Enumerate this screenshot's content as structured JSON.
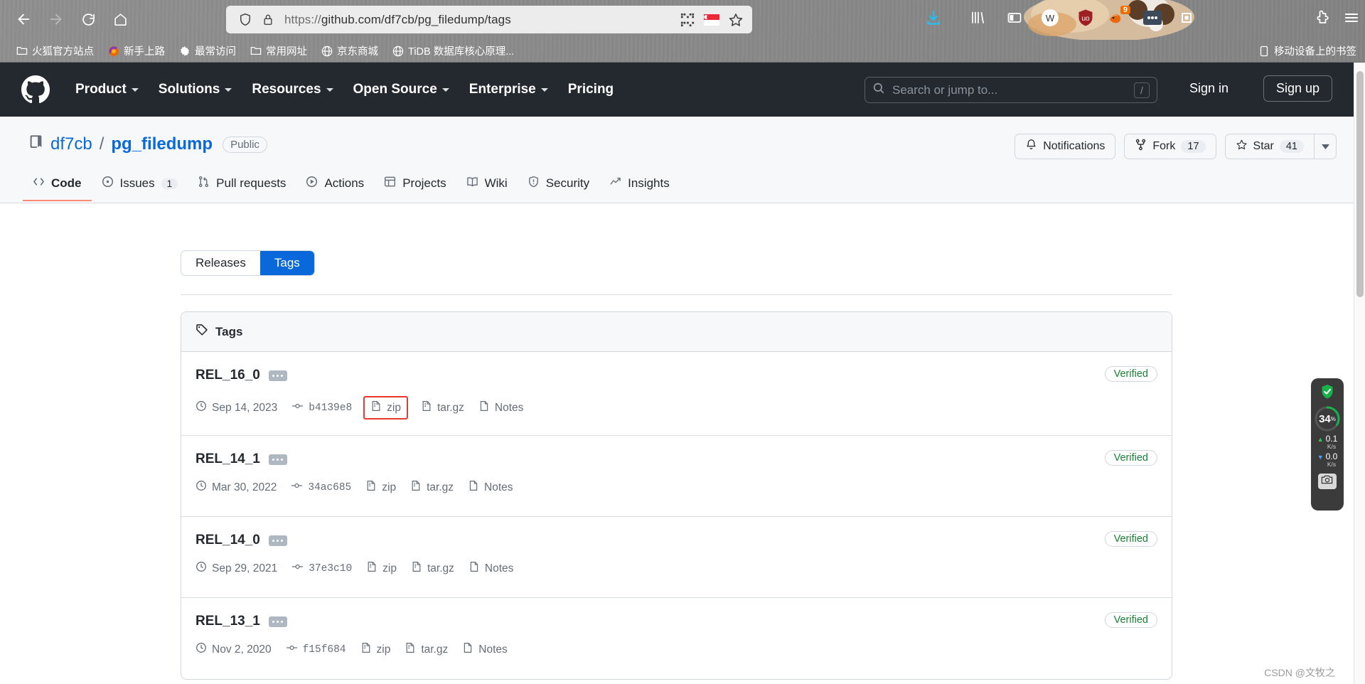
{
  "browser": {
    "back_icon": "back-arrow-icon",
    "forward_icon": "forward-arrow-icon",
    "reload_icon": "reload-icon",
    "home_icon": "home-icon",
    "url_scheme": "https://",
    "url_rest": "github.com/df7cb/pg_filedump/tags",
    "url_full": "https://github.com/df7cb/pg_filedump/tags",
    "shield_icon": "shield-icon",
    "lock_icon": "padlock-icon",
    "qr_icon": "qr-code-icon",
    "flag_icon": "singapore-flag-icon",
    "bookmark_star_icon": "bookmark-star-icon",
    "downloads_icon": "downloads-icon",
    "library_icon": "library-icon",
    "sidebar_icon": "sidebar-icon",
    "account_icon": "w-account-icon",
    "ublock_icon": "ublock-origin-icon",
    "fox_icon": "firefox-extension-icon",
    "fox_badge": "9",
    "dots_ext_icon": "more-extension-icon",
    "screenshot_ext_icon": "screenshot-extension-icon",
    "puzzle_icon": "extensions-puzzle-icon",
    "menu_icon": "hamburger-menu-icon",
    "bookmarks": [
      {
        "label": "火狐官方站点",
        "icon": "folder-icon"
      },
      {
        "label": "新手上路",
        "icon": "firefox-icon"
      },
      {
        "label": "最常访问",
        "icon": "gear-icon"
      },
      {
        "label": "常用网址",
        "icon": "folder-icon"
      },
      {
        "label": "京东商城",
        "icon": "globe-icon"
      },
      {
        "label": "TiDB 数据库核心原理...",
        "icon": "globe-icon"
      }
    ],
    "bookmarks_right": {
      "label": "移动设备上的书签",
      "icon": "mobile-bookmarks-icon"
    }
  },
  "github_header": {
    "logo_icon": "github-mark-icon",
    "nav": [
      {
        "label": "Product",
        "has_caret": true
      },
      {
        "label": "Solutions",
        "has_caret": true
      },
      {
        "label": "Resources",
        "has_caret": true
      },
      {
        "label": "Open Source",
        "has_caret": true
      },
      {
        "label": "Enterprise",
        "has_caret": true
      },
      {
        "label": "Pricing",
        "has_caret": false
      }
    ],
    "search_placeholder": "Search or jump to...",
    "search_icon": "search-icon",
    "search_shortcut": "/",
    "sign_in": "Sign in",
    "sign_up": "Sign up"
  },
  "repo": {
    "book_icon": "repo-book-icon",
    "owner": "df7cb",
    "separator": "/",
    "name": "pg_filedump",
    "visibility": "Public",
    "actions": {
      "notifications_label": "Notifications",
      "notifications_icon": "bell-icon",
      "fork_label": "Fork",
      "fork_count": "17",
      "fork_icon": "fork-icon",
      "star_label": "Star",
      "star_count": "41",
      "star_icon": "star-icon",
      "caret_icon": "chevron-down-icon"
    },
    "tabs": [
      {
        "label": "Code",
        "icon": "code-icon",
        "count": "",
        "active": true
      },
      {
        "label": "Issues",
        "icon": "issue-opened-icon",
        "count": "1",
        "active": false
      },
      {
        "label": "Pull requests",
        "icon": "pull-request-icon",
        "count": "",
        "active": false
      },
      {
        "label": "Actions",
        "icon": "play-icon",
        "count": "",
        "active": false
      },
      {
        "label": "Projects",
        "icon": "table-icon",
        "count": "",
        "active": false
      },
      {
        "label": "Wiki",
        "icon": "book-icon",
        "count": "",
        "active": false
      },
      {
        "label": "Security",
        "icon": "shield-icon",
        "count": "",
        "active": false
      },
      {
        "label": "Insights",
        "icon": "graph-icon",
        "count": "",
        "active": false
      }
    ]
  },
  "main": {
    "toggle": {
      "releases": "Releases",
      "tags": "Tags",
      "active": "Tags"
    },
    "card_title": "Tags",
    "card_title_icon": "tag-icon",
    "meta_icons": {
      "date": "clock-icon",
      "commit": "commit-icon",
      "zip": "file-zip-icon",
      "targz": "file-zip-icon",
      "notes": "file-icon"
    },
    "verified_label": "Verified",
    "tags": [
      {
        "name": "REL_16_0",
        "date": "Sep 14, 2023",
        "commit": "b4139e8",
        "zip": "zip",
        "targz": "tar.gz",
        "notes": "Notes",
        "verified": "Verified",
        "zip_highlighted": true
      },
      {
        "name": "REL_14_1",
        "date": "Mar 30, 2022",
        "commit": "34ac685",
        "zip": "zip",
        "targz": "tar.gz",
        "notes": "Notes",
        "verified": "Verified",
        "zip_highlighted": false
      },
      {
        "name": "REL_14_0",
        "date": "Sep 29, 2021",
        "commit": "37e3c10",
        "zip": "zip",
        "targz": "tar.gz",
        "notes": "Notes",
        "verified": "Verified",
        "zip_highlighted": false
      },
      {
        "name": "REL_13_1",
        "date": "Nov 2, 2020",
        "commit": "f15f684",
        "zip": "zip",
        "targz": "tar.gz",
        "notes": "Notes",
        "verified": "Verified",
        "zip_highlighted": false
      }
    ]
  },
  "speed_widget": {
    "shield_icon": "security-shield-icon",
    "gauge_value": "34",
    "gauge_unit": "%",
    "upload": {
      "arrow": "▲",
      "value": "0.1",
      "unit": "K/s"
    },
    "download": {
      "arrow": "▼",
      "value": "0.0",
      "unit": "K/s"
    },
    "camera_icon": "screenshot-camera-icon"
  },
  "watermark": "CSDN @文牧之",
  "colors": {
    "gh_header_bg": "#24292f",
    "accent_blue": "#0969da",
    "verified_green": "#1a7f37",
    "highlight_red": "#e8392f",
    "tab_underline": "#fd8c73"
  }
}
